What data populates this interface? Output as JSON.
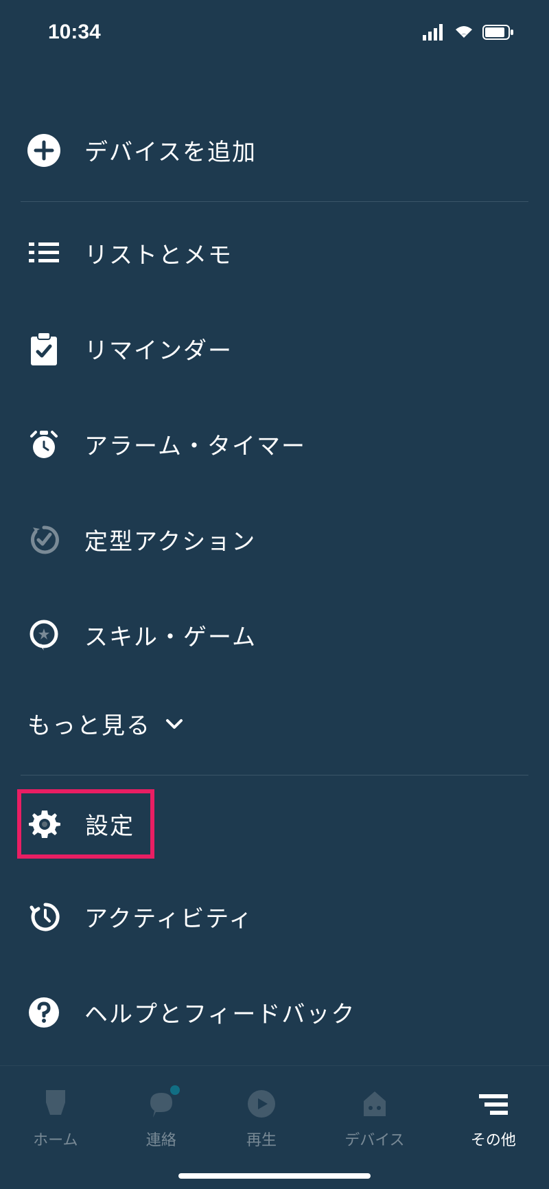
{
  "statusBar": {
    "time": "10:34"
  },
  "menu": {
    "addDevice": "デバイスを追加",
    "listsNotes": "リストとメモ",
    "reminders": "リマインダー",
    "alarmsTimers": "アラーム・タイマー",
    "routines": "定型アクション",
    "skillsGames": "スキル・ゲーム",
    "showMore": "もっと見る",
    "settings": "設定",
    "activity": "アクティビティ",
    "helpFeedback": "ヘルプとフィードバック"
  },
  "tabs": {
    "home": "ホーム",
    "communicate": "連絡",
    "play": "再生",
    "devices": "デバイス",
    "more": "その他"
  }
}
